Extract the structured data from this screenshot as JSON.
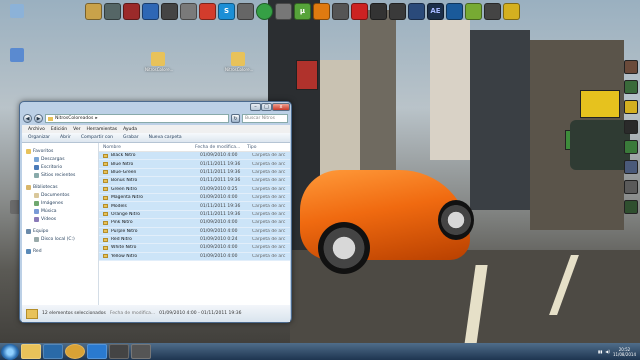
{
  "window": {
    "title_minimize": "–",
    "title_maximize": "□",
    "title_close": "x",
    "breadcrumb": [
      "NitrosColoreados"
    ],
    "search_placeholder": "Buscar Nitros",
    "menu": [
      "Archivo",
      "Edición",
      "Ver",
      "Herramientas",
      "Ayuda"
    ],
    "commands": [
      "Organizar",
      "Abrir",
      "Compartir con",
      "Grabar",
      "Nueva carpeta"
    ],
    "nav": {
      "favorites": "Favoritos",
      "favorites_items": [
        "Descargas",
        "Escritorio",
        "Sitios recientes"
      ],
      "libraries": "Bibliotecas",
      "libraries_items": [
        "Documentos",
        "Imágenes",
        "Música",
        "Vídeos"
      ],
      "computer": "Equipo",
      "computer_items": [
        "Disco local (C:)"
      ],
      "network": "Red"
    },
    "columns": {
      "name": "Nombre",
      "date": "Fecha de modifica...",
      "type": "Tipo"
    },
    "rows": [
      {
        "name": "Black Nitro",
        "date": "01/09/2010 4:00",
        "type": "Carpeta de arc"
      },
      {
        "name": "Blue Nitro",
        "date": "01/11/2011 19:36",
        "type": "Carpeta de arc"
      },
      {
        "name": "Blue-Green",
        "date": "01/11/2011 19:36",
        "type": "Carpeta de arc"
      },
      {
        "name": "Bonus Nitro",
        "date": "01/11/2011 19:36",
        "type": "Carpeta de arc"
      },
      {
        "name": "Green Nitro",
        "date": "01/09/2010 0:25",
        "type": "Carpeta de arc"
      },
      {
        "name": "Magenta Nitro",
        "date": "01/09/2010 4:00",
        "type": "Carpeta de arc"
      },
      {
        "name": "Models",
        "date": "01/11/2011 19:36",
        "type": "Carpeta de arc"
      },
      {
        "name": "Orange Nitro",
        "date": "01/11/2011 19:36",
        "type": "Carpeta de arc"
      },
      {
        "name": "Pink Nitro",
        "date": "01/09/2010 4:00",
        "type": "Carpeta de arc"
      },
      {
        "name": "Purple Nitro",
        "date": "01/09/2010 4:00",
        "type": "Carpeta de arc"
      },
      {
        "name": "Red Nitro",
        "date": "01/09/2010 0:24",
        "type": "Carpeta de arc"
      },
      {
        "name": "White Nitro",
        "date": "01/09/2010 4:00",
        "type": "Carpeta de arc"
      },
      {
        "name": "Yellow Nitro",
        "date": "01/09/2010 4:00",
        "type": "Carpeta de arc"
      }
    ],
    "status": {
      "count": "12 elementos seleccionados",
      "date_label": "Fecha de modifica...",
      "date_range": "01/09/2010 4:00 - 01/11/2011 19:36"
    }
  },
  "desktop_icons": [
    {
      "label": "NitrosColore..."
    },
    {
      "label": "NitrosColore..."
    }
  ],
  "top_icons": [
    "S",
    "µ",
    "AE"
  ],
  "taskbar": {
    "clock_time": "20:52",
    "clock_date": "11/08/2014"
  },
  "colors": {
    "selection": "#cce4f8",
    "folder": "#e8c25a",
    "car": "#f06a10",
    "taskbar": "#1e3550"
  }
}
